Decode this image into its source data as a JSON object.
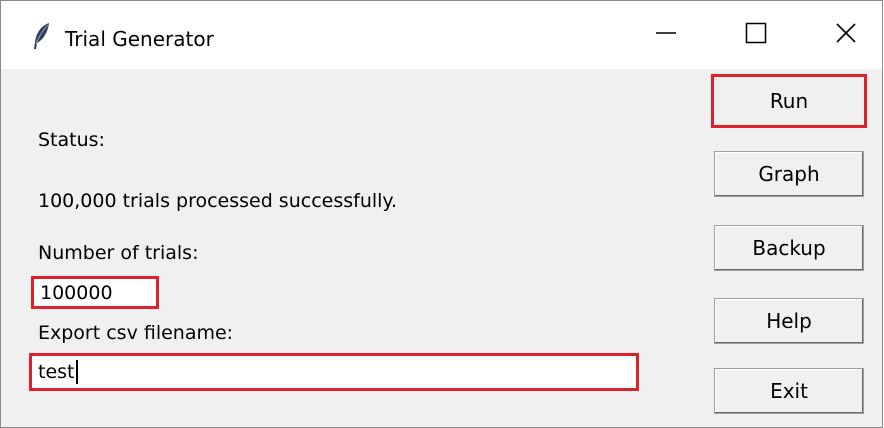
{
  "window": {
    "title": "Trial Generator",
    "app_icon": "feather-icon",
    "controls": {
      "minimize_icon": "minimize-icon",
      "maximize_icon": "maximize-icon",
      "close_icon": "close-icon"
    }
  },
  "status": {
    "label": "Status:",
    "message": "100,000 trials processed successfully."
  },
  "trials": {
    "label": "Number of trials:",
    "value": "100000"
  },
  "export": {
    "label": "Export csv filename:",
    "value": "test"
  },
  "buttons": {
    "run": "Run",
    "graph": "Graph",
    "backup": "Backup",
    "help": "Help",
    "exit": "Exit"
  },
  "colors": {
    "highlight": "#e0202a",
    "window_bg": "#f0f0f0",
    "titlebar_bg": "#ffffff"
  }
}
